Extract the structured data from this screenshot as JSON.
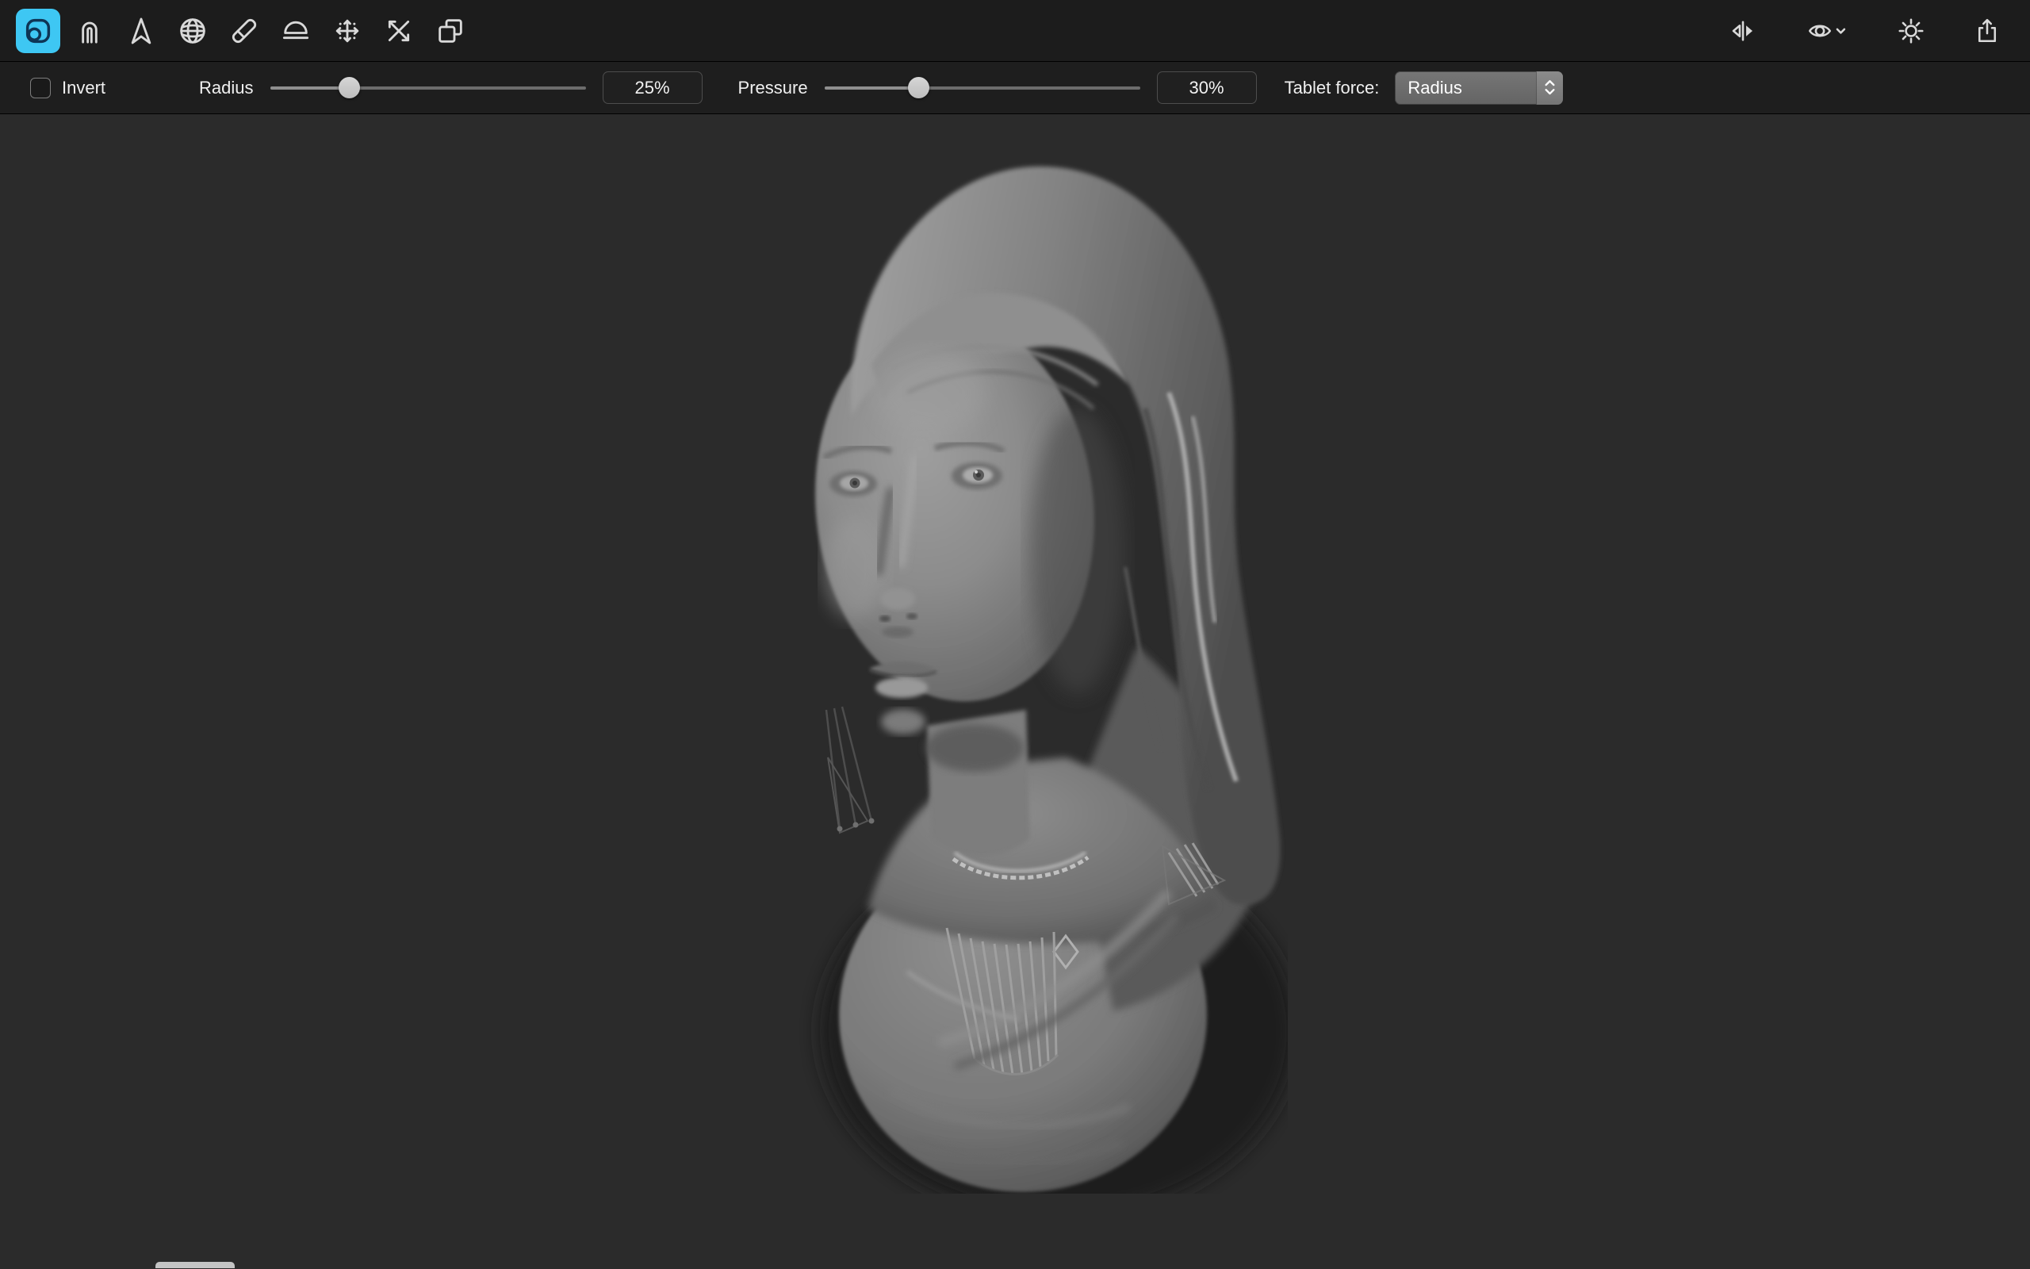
{
  "window": {
    "background": "#2b2b2b",
    "toolbar_background": "#1c1c1c",
    "optionsbar_background": "#1e1e1e"
  },
  "toolbar": {
    "active_tool_style": "background:#3ec7f3",
    "active_tool_color": "#3ec7f3",
    "left_tools": [
      {
        "id": "sculpt-brush-tool",
        "icon": "clay-brush-icon",
        "active": true
      },
      {
        "id": "magnet-tool",
        "icon": "magnet-icon",
        "active": false
      },
      {
        "id": "pinch-tool",
        "icon": "arrow-peak-icon",
        "active": false
      },
      {
        "id": "sphere-tool",
        "icon": "wireframe-globe-icon",
        "active": false
      },
      {
        "id": "eraser-tool",
        "icon": "eraser-icon",
        "active": false
      },
      {
        "id": "hemisphere-tool",
        "icon": "hemisphere-icon",
        "active": false
      },
      {
        "id": "expand-tool",
        "icon": "four-way-arrows-icon",
        "active": false
      },
      {
        "id": "collapse-tool",
        "icon": "crossed-arrows-icon",
        "active": false
      },
      {
        "id": "transform-tool",
        "icon": "overlapping-squares-icon",
        "active": false
      }
    ],
    "right_controls": [
      {
        "id": "mirror-toggle",
        "icon": "mirror-icon"
      },
      {
        "id": "visibility-menu",
        "icon": "eye-chevron-icon"
      },
      {
        "id": "lighting-toggle",
        "icon": "sun-icon"
      },
      {
        "id": "share-button",
        "icon": "share-icon"
      }
    ]
  },
  "options": {
    "invert": {
      "label": "Invert",
      "checked": false
    },
    "radius": {
      "label": "Radius",
      "value": "25%",
      "percent": 25
    },
    "pressure": {
      "label": "Pressure",
      "value": "30%",
      "percent": 30
    },
    "tablet_force": {
      "label": "Tablet force:",
      "selected": "Radius"
    }
  },
  "viewport": {
    "description": "Grayscale 3D sculpted bust of a woman with long wavy hair, beaded necklace and dangling earring, on a circular base",
    "background": "#2b2b2b"
  }
}
